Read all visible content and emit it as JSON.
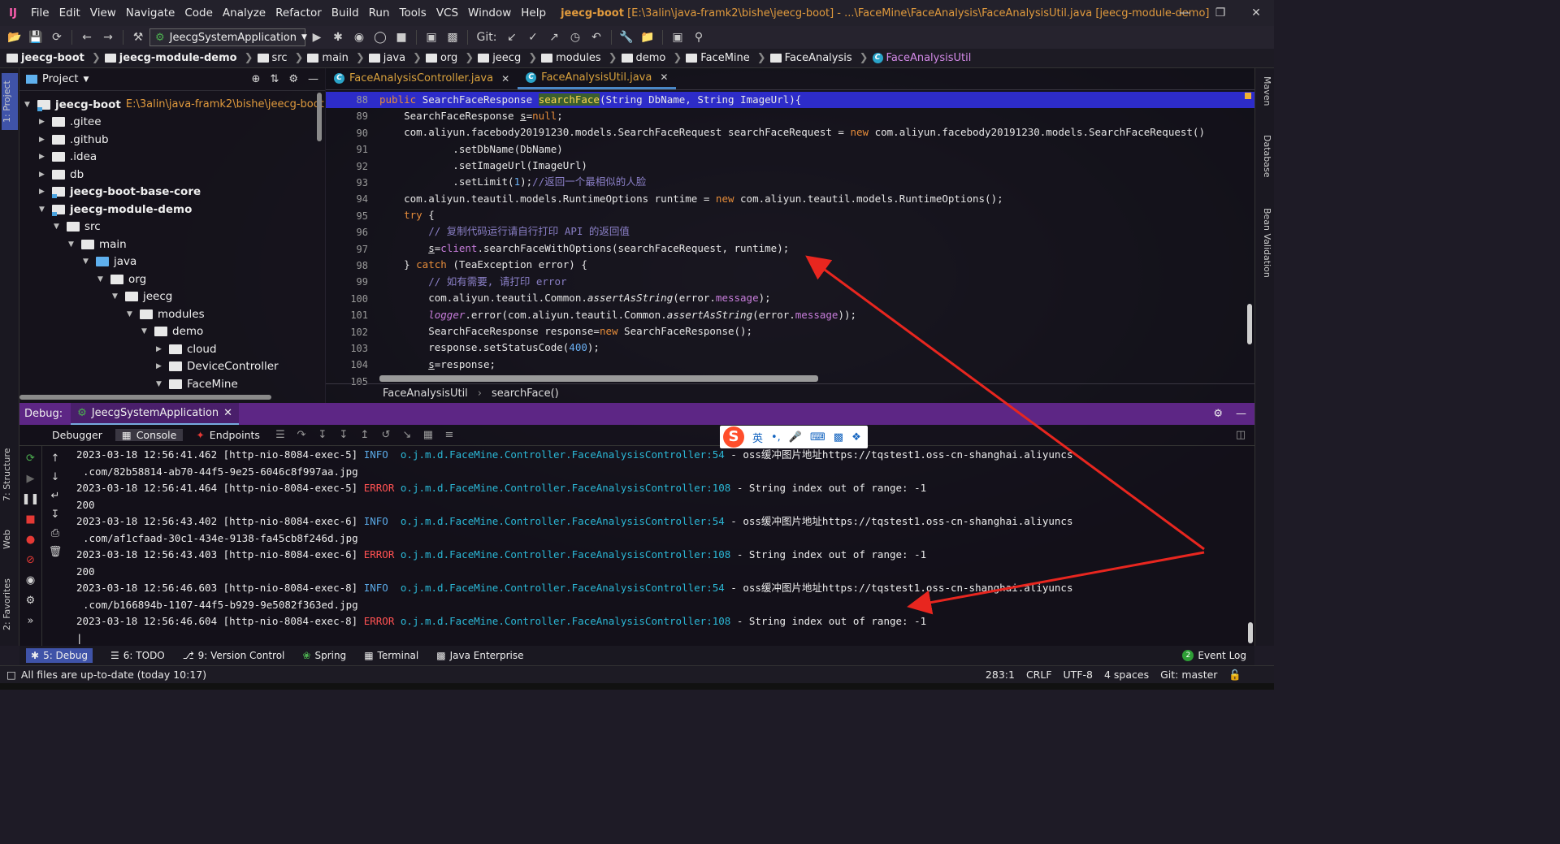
{
  "menubar": {
    "items": [
      "File",
      "Edit",
      "View",
      "Navigate",
      "Code",
      "Analyze",
      "Refactor",
      "Build",
      "Run",
      "Tools",
      "VCS",
      "Window",
      "Help"
    ],
    "title_project": "jeecg-boot",
    "title_rest": "[E:\\3alin\\java-framk2\\bishe\\jeecg-boot] - ...\\FaceMine\\FaceAnalysis\\FaceAnalysisUtil.java [jeecg-module-demo]"
  },
  "toolbar": {
    "run_config": "JeecgSystemApplication",
    "git_label": "Git:"
  },
  "breadcrumbs": [
    "jeecg-boot",
    "jeecg-module-demo",
    "src",
    "main",
    "java",
    "org",
    "jeecg",
    "modules",
    "demo",
    "FaceMine",
    "FaceAnalysis",
    "FaceAnalysisUtil"
  ],
  "project_panel": {
    "title": "Project",
    "tree": [
      {
        "label": "jeecg-boot",
        "path": "E:\\3alin\\java-framk2\\bishe\\jeecg-boot",
        "depth": 0,
        "open": true,
        "bold": true,
        "icon": "module-folder"
      },
      {
        "label": ".gitee",
        "depth": 1,
        "open": false,
        "icon": "folder"
      },
      {
        "label": ".github",
        "depth": 1,
        "open": false,
        "icon": "folder"
      },
      {
        "label": ".idea",
        "depth": 1,
        "open": false,
        "icon": "folder"
      },
      {
        "label": "db",
        "depth": 1,
        "open": false,
        "icon": "folder"
      },
      {
        "label": "jeecg-boot-base-core",
        "depth": 1,
        "open": false,
        "bold": true,
        "icon": "module-folder"
      },
      {
        "label": "jeecg-module-demo",
        "depth": 1,
        "open": true,
        "bold": true,
        "icon": "module-folder"
      },
      {
        "label": "src",
        "depth": 2,
        "open": true,
        "icon": "folder"
      },
      {
        "label": "main",
        "depth": 3,
        "open": true,
        "icon": "folder"
      },
      {
        "label": "java",
        "depth": 4,
        "open": true,
        "icon": "source-folder"
      },
      {
        "label": "org",
        "depth": 5,
        "open": true,
        "icon": "folder"
      },
      {
        "label": "jeecg",
        "depth": 6,
        "open": true,
        "icon": "folder"
      },
      {
        "label": "modules",
        "depth": 7,
        "open": true,
        "icon": "folder"
      },
      {
        "label": "demo",
        "depth": 8,
        "open": true,
        "icon": "folder"
      },
      {
        "label": "cloud",
        "depth": 9,
        "open": false,
        "icon": "folder"
      },
      {
        "label": "DeviceController",
        "depth": 9,
        "open": false,
        "icon": "folder"
      },
      {
        "label": "FaceMine",
        "depth": 9,
        "open": true,
        "icon": "folder"
      }
    ]
  },
  "editor": {
    "tabs": [
      {
        "label": "FaceAnalysisController.java",
        "active": false
      },
      {
        "label": "FaceAnalysisUtil.java",
        "active": true
      }
    ],
    "line_numbers": [
      "88",
      "89",
      "90",
      "91",
      "92",
      "93",
      "94",
      "95",
      "96",
      "97",
      "98",
      "99",
      "100",
      "101",
      "102",
      "103",
      "104",
      "105"
    ],
    "breadcrumb_class": "FaceAnalysisUtil",
    "breadcrumb_method": "searchFace()"
  },
  "debug": {
    "title": "Debug:",
    "run_tab": "JeecgSystemApplication",
    "tabs": [
      "Debugger",
      "Console",
      "Endpoints"
    ],
    "logs": [
      {
        "ts": "2023-03-18 12:56:41.462",
        "thread": "[http-nio-8084-exec-5]",
        "level": "INFO",
        "logger": "o.j.m.d.FaceMine.Controller.FaceAnalysisController:54",
        "msg": "- oss缓冲图片地址https://tqstest1.oss-cn-shanghai.aliyuncs"
      },
      {
        "cont": ".com/82b58814-ab70-44f5-9e25-6046c8f997aa.jpg"
      },
      {
        "ts": "2023-03-18 12:56:41.464",
        "thread": "[http-nio-8084-exec-5]",
        "level": "ERROR",
        "logger": "o.j.m.d.FaceMine.Controller.FaceAnalysisController:108",
        "msg": "- String index out of range: -1"
      },
      {
        "cont": "200"
      },
      {
        "ts": "2023-03-18 12:56:43.402",
        "thread": "[http-nio-8084-exec-6]",
        "level": "INFO",
        "logger": "o.j.m.d.FaceMine.Controller.FaceAnalysisController:54",
        "msg": "- oss缓冲图片地址https://tqstest1.oss-cn-shanghai.aliyuncs"
      },
      {
        "cont": ".com/af1cfaad-30c1-434e-9138-fa45cb8f246d.jpg"
      },
      {
        "ts": "2023-03-18 12:56:43.403",
        "thread": "[http-nio-8084-exec-6]",
        "level": "ERROR",
        "logger": "o.j.m.d.FaceMine.Controller.FaceAnalysisController:108",
        "msg": "- String index out of range: -1"
      },
      {
        "cont": "200"
      },
      {
        "ts": "2023-03-18 12:56:46.603",
        "thread": "[http-nio-8084-exec-8]",
        "level": "INFO",
        "logger": "o.j.m.d.FaceMine.Controller.FaceAnalysisController:54",
        "msg": "- oss缓冲图片地址https://tqstest1.oss-cn-shanghai.aliyuncs"
      },
      {
        "cont": ".com/b166894b-1107-44f5-b929-9e5082f363ed.jpg"
      },
      {
        "ts": "2023-03-18 12:56:46.604",
        "thread": "[http-nio-8084-exec-8]",
        "level": "ERROR",
        "logger": "o.j.m.d.FaceMine.Controller.FaceAnalysisController:108",
        "msg": "- String index out of range: -1"
      }
    ]
  },
  "ime": {
    "mode": "英"
  },
  "bottom_tabs": [
    {
      "label": "5: Debug",
      "selected": true
    },
    {
      "label": "6: TODO"
    },
    {
      "label": "9: Version Control"
    },
    {
      "label": "Spring"
    },
    {
      "label": "Terminal"
    },
    {
      "label": "Java Enterprise"
    }
  ],
  "event_log": {
    "label": "Event Log",
    "count": "2"
  },
  "statusbar": {
    "message": "All files are up-to-date (today 10:17)",
    "position": "283:1",
    "line_sep": "CRLF",
    "encoding": "UTF-8",
    "indent": "4 spaces",
    "git": "Git: master"
  },
  "side_tabs": {
    "left": [
      "1: Project",
      "7: Structure",
      "Web",
      "2: Favorites"
    ],
    "right": [
      "Maven",
      "Database",
      "Bean Validation"
    ]
  },
  "colors": {
    "debug_header": "#5d2685",
    "current_line": "#2d2cc9",
    "annotation_arrow": "#e8261f"
  }
}
